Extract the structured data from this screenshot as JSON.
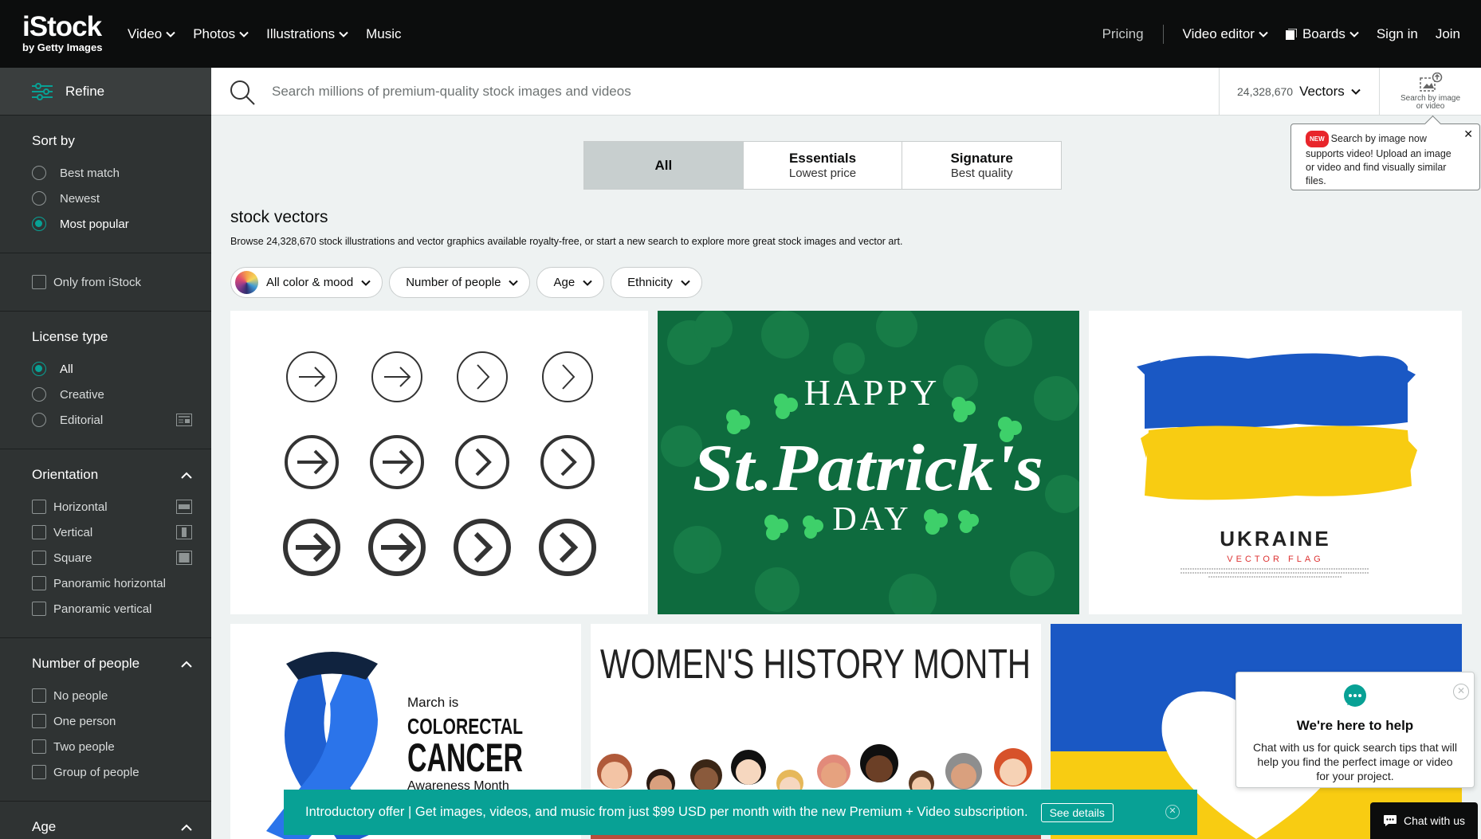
{
  "brand": {
    "name": "iStock",
    "sub": "by Getty Images"
  },
  "nav": {
    "left": [
      {
        "label": "Video",
        "has_menu": true
      },
      {
        "label": "Photos",
        "has_menu": true
      },
      {
        "label": "Illustrations",
        "has_menu": true
      },
      {
        "label": "Music",
        "has_menu": false
      }
    ],
    "pricing": "Pricing",
    "video_editor": "Video editor",
    "boards": "Boards",
    "sign_in": "Sign in",
    "join": "Join"
  },
  "sidebar": {
    "refine": "Refine",
    "sort": {
      "title": "Sort by",
      "options": [
        "Best match",
        "Newest",
        "Most popular"
      ],
      "selected": "Most popular"
    },
    "only_istock": "Only from iStock",
    "license": {
      "title": "License type",
      "options": [
        "All",
        "Creative",
        "Editorial"
      ],
      "selected": "All"
    },
    "orientation": {
      "title": "Orientation",
      "options": [
        "Horizontal",
        "Vertical",
        "Square",
        "Panoramic horizontal",
        "Panoramic vertical"
      ]
    },
    "people": {
      "title": "Number of people",
      "options": [
        "No people",
        "One person",
        "Two people",
        "Group of people"
      ]
    },
    "age": {
      "title": "Age"
    }
  },
  "search": {
    "placeholder": "Search millions of premium-quality stock images and videos",
    "count": "24,328,670",
    "asset_type": "Vectors",
    "image_search_label_1": "Search by image",
    "image_search_label_2": "or video"
  },
  "tooltip": {
    "badge": "NEW",
    "text": "Search by image now supports video! Upload an image or video and find visually similar files.",
    "close": "✕"
  },
  "tiers": [
    {
      "label": "All",
      "sub": "",
      "active": true
    },
    {
      "label": "Essentials",
      "sub": "Lowest price",
      "active": false
    },
    {
      "label": "Signature",
      "sub": "Best quality",
      "active": false
    }
  ],
  "page": {
    "title": "stock vectors",
    "description": "Browse 24,328,670 stock illustrations and vector graphics available royalty-free, or start a new search to explore more great stock images and vector art."
  },
  "filters": [
    {
      "label": "All color & mood"
    },
    {
      "label": "Number of people"
    },
    {
      "label": "Age"
    },
    {
      "label": "Ethnicity"
    }
  ],
  "images": {
    "patrick_1": "HAPPY",
    "patrick_2": "St.Patrick's",
    "patrick_3": "DAY",
    "ukraine_1": "UKRAINE",
    "ukraine_2": "VECTOR FLAG",
    "ribbon_1": "March is",
    "ribbon_2": "COLORECTAL",
    "ribbon_3": "CANCER",
    "ribbon_4": "Awareness Month",
    "women": "WOMEN'S  HISTORY  MONTH"
  },
  "chat": {
    "title": "We're here to help",
    "body": "Chat with us for quick search tips that will help you find the perfect image or video for your project.",
    "button": "Chat with us",
    "close": "✕"
  },
  "promo": {
    "text": "Introductory offer | Get images, videos, and music from just $99 USD per month with the new Premium + Video subscription.",
    "button": "See details",
    "close": "✕"
  },
  "colors": {
    "accent": "#08a195",
    "nav_bg": "#0c0d0d",
    "sidebar_bg": "#2f3333",
    "patrick_green": "#0e6b3e",
    "ukraine_blue": "#1a58c4",
    "ukraine_yellow": "#f8cc12"
  }
}
